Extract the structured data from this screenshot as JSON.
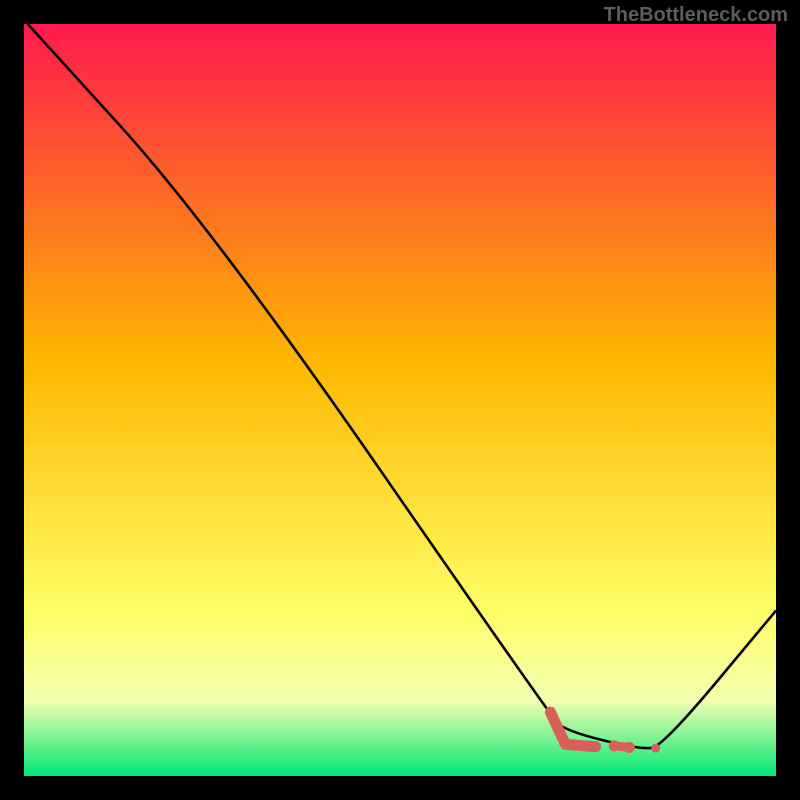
{
  "watermark": "TheBottleneck.com",
  "chart_data": {
    "type": "line",
    "title": "",
    "xlabel": "",
    "ylabel": "",
    "xlim": [
      0,
      100
    ],
    "ylim": [
      0,
      100
    ],
    "background_gradient": {
      "top": "#ff1a4d",
      "upper_mid": "#ffb700",
      "lower_mid": "#ffff66",
      "bottom": "#00e676"
    },
    "series": [
      {
        "name": "curve",
        "type": "line",
        "color": "#000000",
        "points": [
          {
            "x": 0.5,
            "y": 100
          },
          {
            "x": 25,
            "y": 73
          },
          {
            "x": 70,
            "y": 8
          },
          {
            "x": 72,
            "y": 6
          },
          {
            "x": 82,
            "y": 3.5
          },
          {
            "x": 85,
            "y": 4
          },
          {
            "x": 100,
            "y": 22
          }
        ]
      },
      {
        "name": "highlight",
        "type": "line",
        "color": "#d9605a",
        "points": [
          {
            "x": 70,
            "y": 8.5
          },
          {
            "x": 72,
            "y": 4.2
          },
          {
            "x": 76,
            "y": 3.9
          },
          {
            "x": 78.5,
            "y": 4.0
          },
          {
            "x": 80.5,
            "y": 3.8
          },
          {
            "x": 84,
            "y": 3.7
          }
        ]
      }
    ]
  }
}
